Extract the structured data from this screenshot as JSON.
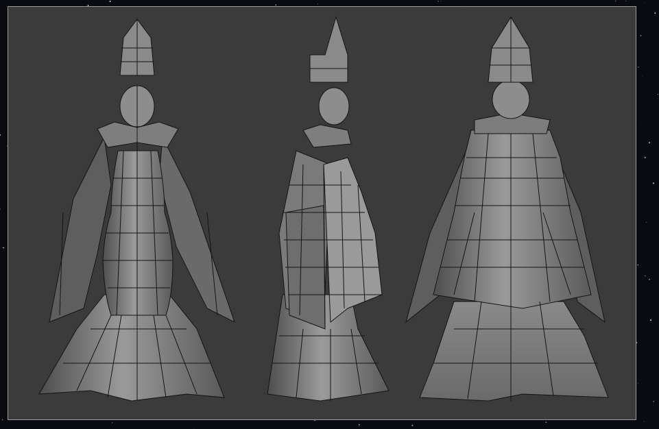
{
  "scene": {
    "background_color": "#0a0b10",
    "viewport_color": "#3b3b3b",
    "viewport_border_color": "#9a9a9a",
    "mesh_fill_color": "#8e8e8e",
    "mesh_shade_color": "#5d5d5d",
    "wire_color": "#141414"
  },
  "models": [
    {
      "view": "front"
    },
    {
      "view": "side"
    },
    {
      "view": "back"
    }
  ]
}
